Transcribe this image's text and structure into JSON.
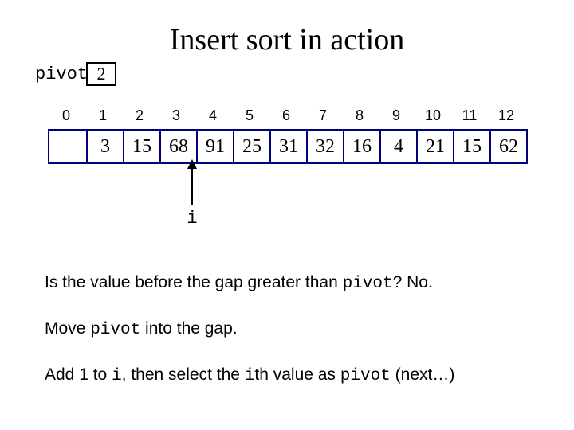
{
  "title": "Insert sort in action",
  "pivot": {
    "label": "pivot",
    "value": "2"
  },
  "indices": [
    "0",
    "1",
    "2",
    "3",
    "4",
    "5",
    "6",
    "7",
    "8",
    "9",
    "10",
    "11",
    "12"
  ],
  "cells": [
    "",
    "3",
    "15",
    "68",
    "91",
    "25",
    "31",
    "32",
    "16",
    "4",
    "21",
    "15",
    "62"
  ],
  "pointer": {
    "label": "i"
  },
  "text": {
    "l1a": "Is the value before the gap greater than ",
    "l1b": "pivot",
    "l1c": "? No.",
    "l2a": "Move ",
    "l2b": "pivot",
    "l2c": " into the gap.",
    "l3a": "Add 1 to ",
    "l3b": "i",
    "l3c": ", then select the ",
    "l3d": "i",
    "l3e": "th value as ",
    "l3f": "pivot",
    "l3g": " (next…)"
  }
}
